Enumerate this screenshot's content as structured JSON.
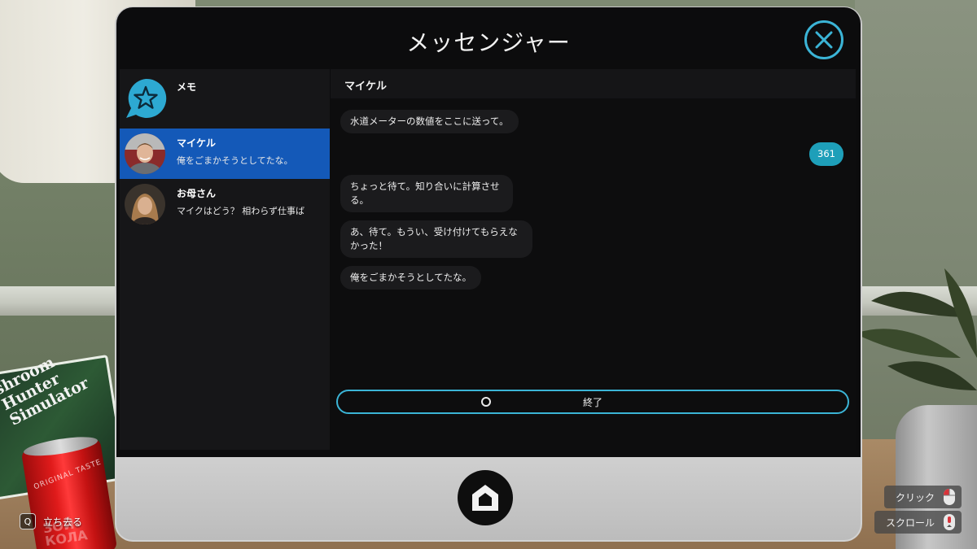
{
  "app": {
    "title": "メッセンジャー"
  },
  "sidebar": {
    "contacts": [
      {
        "name": "メモ",
        "preview": "",
        "avatar": "star-chat-icon",
        "selected": false
      },
      {
        "name": "マイケル",
        "preview": "俺をごまかそうとしてたな。",
        "avatar": "michael-avatar",
        "selected": true
      },
      {
        "name": "お母さん",
        "preview": "マイクはどう？ 相わらず仕事ば",
        "avatar": "mother-avatar",
        "selected": false
      }
    ]
  },
  "chat": {
    "contact_name": "マイケル",
    "messages": [
      {
        "direction": "in",
        "text": "水道メーターの数値をここに送って。"
      },
      {
        "direction": "out",
        "text": "361"
      },
      {
        "direction": "in",
        "text": "ちょっと待て。知り合いに計算させる。"
      },
      {
        "direction": "in",
        "text": "あ、待て。もうい、受け付けてもらえなかった！"
      },
      {
        "direction": "in",
        "text": "俺をごまかそうとしてたな。"
      }
    ],
    "end_button": "終了"
  },
  "hud": {
    "stand_key": "Q",
    "stand_label": "立ち去る",
    "click_label": "クリック",
    "scroll_label": "スクロール"
  },
  "scene": {
    "book_title_lines": [
      "shroom",
      "Hunter",
      "Simulator"
    ],
    "can_text": "ORIGINAL TASTE",
    "can_brand": "ЗОЙ КОЛА"
  },
  "colors": {
    "accent": "#3bb4d6",
    "selected": "#1459b8",
    "outgoing_bubble": "#1e9fb9",
    "incoming_bubble": "#1b1b1d"
  }
}
